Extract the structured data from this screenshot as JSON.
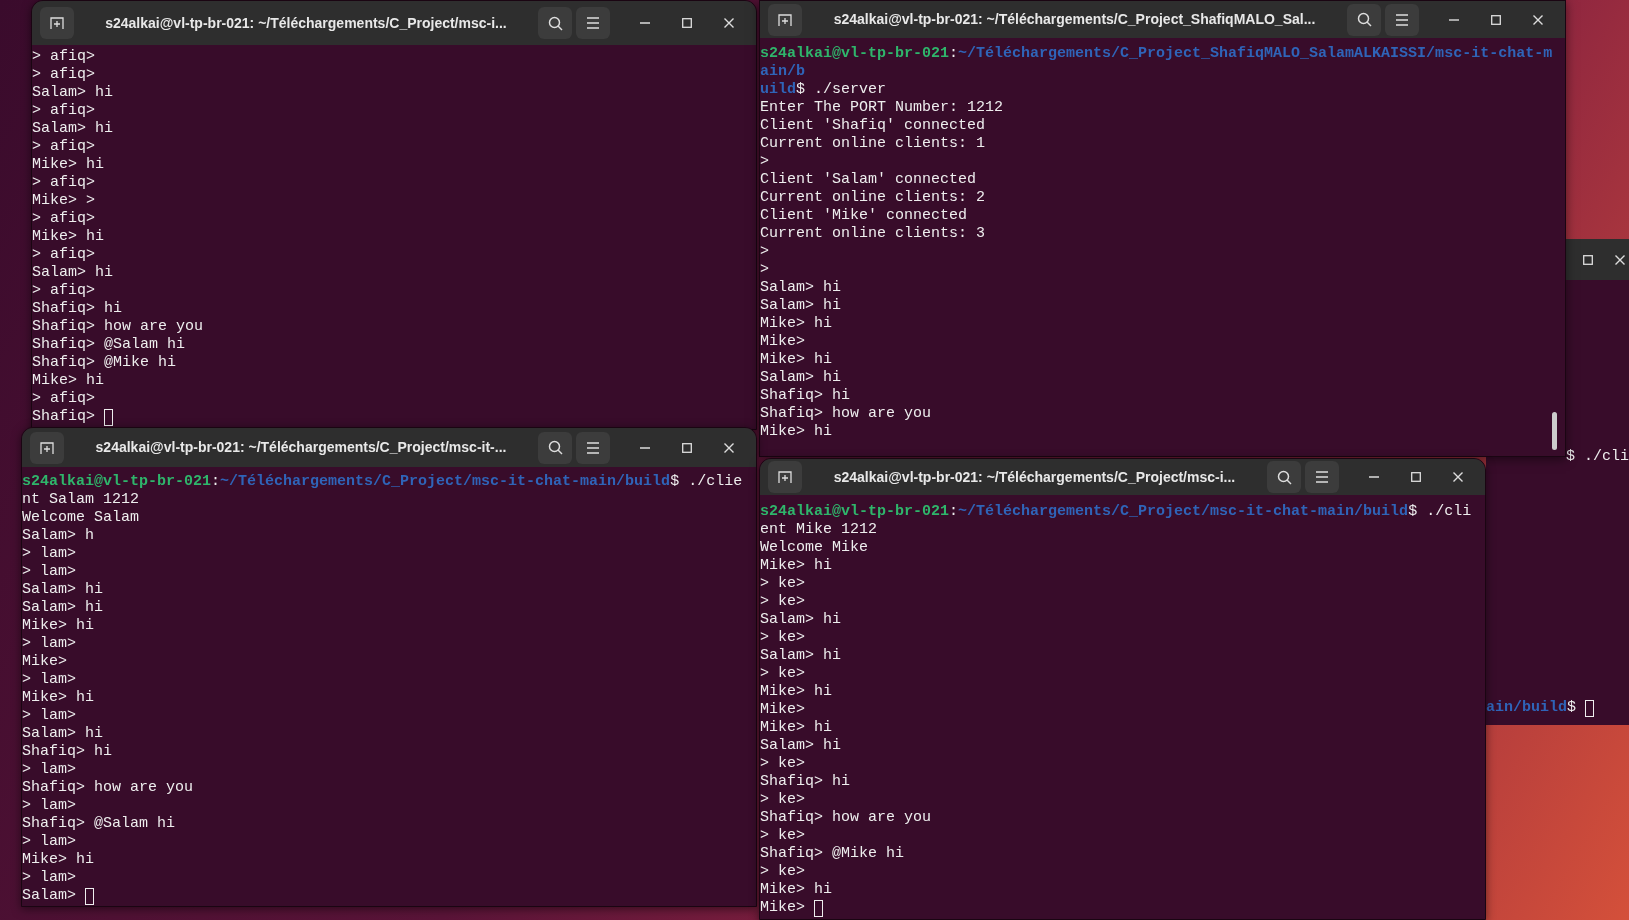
{
  "windows": [
    {
      "title": "s24alkai@vl-tp-br-021: ~/Téléchargements/C_Project/msc-i...",
      "lines": [
        "> afiq>",
        "> afiq>",
        "Salam> hi",
        "> afiq>",
        "Salam> hi",
        "> afiq>",
        "Mike> hi",
        "> afiq>",
        "Mike> >",
        "> afiq>",
        "Mike> hi",
        "> afiq>",
        "Salam> hi",
        "> afiq>",
        "Shafiq> hi",
        "Shafiq> how are you",
        "Shafiq> @Salam hi",
        "Shafiq> @Mike hi",
        "Mike> hi",
        "> afiq>",
        {
          "parts": [
            {
              "kind": "plain",
              "text": "Shafiq> "
            }
          ],
          "cursor": true
        }
      ]
    },
    {
      "title": "s24alkai@vl-tp-br-021: ~/Téléchargements/C_Project_ShafiqMALO_Sal...",
      "lines": [
        {
          "parts": [
            {
              "kind": "user",
              "text": "s24alkai@vl-tp-br-021"
            },
            {
              "kind": "plain",
              "text": ":"
            },
            {
              "kind": "path",
              "text": "~/Téléchargements/C_Project_ShafiqMALO_SalamALKAISSI/msc-it-chat-m"
            }
          ]
        },
        {
          "parts": [
            {
              "kind": "path",
              "text": "ain/b"
            }
          ]
        },
        {
          "parts": [
            {
              "kind": "path",
              "text": "uild"
            },
            {
              "kind": "plain",
              "text": "$ ./server"
            }
          ]
        },
        "Enter The PORT Number: 1212",
        "Client 'Shafiq' connected",
        "Current online clients: 1",
        ">",
        "Client 'Salam' connected",
        "Current online clients: 2",
        "Client 'Mike' connected",
        "Current online clients: 3",
        ">",
        ">",
        "Salam> hi",
        "Salam> hi",
        "Mike> hi",
        "Mike>",
        "Mike> hi",
        "Salam> hi",
        "Shafiq> hi",
        "Shafiq> how are you",
        "Mike> hi"
      ]
    },
    {
      "title": "s24alkai@vl-tp-br-021: ~/Téléchargements/C_Project/msc-it-...",
      "lines": [
        {
          "parts": [
            {
              "kind": "user",
              "text": "s24alkai@vl-tp-br-021"
            },
            {
              "kind": "plain",
              "text": ":"
            },
            {
              "kind": "path",
              "text": "~/Téléchargements/C_Project/msc-it-chat-main/build"
            },
            {
              "kind": "plain",
              "text": "$ ./clie"
            }
          ]
        },
        "nt Salam 1212",
        "Welcome Salam",
        "Salam> h",
        "> lam>",
        "> lam>",
        "Salam> hi",
        "Salam> hi",
        "Mike> hi",
        "> lam>",
        "Mike>",
        "> lam>",
        "Mike> hi",
        "> lam>",
        "Salam> hi",
        "Shafiq> hi",
        "> lam>",
        "Shafiq> how are you",
        "> lam>",
        "Shafiq> @Salam hi",
        "> lam>",
        "Mike> hi",
        "> lam>",
        {
          "parts": [
            {
              "kind": "plain",
              "text": "Salam> "
            }
          ],
          "cursor": true
        }
      ]
    },
    {
      "title": "s24alkai@vl-tp-br-021: ~/Téléchargements/C_Project/msc-i...",
      "lines": [
        {
          "parts": [
            {
              "kind": "user",
              "text": "s24alkai@vl-tp-br-021"
            },
            {
              "kind": "plain",
              "text": ":"
            },
            {
              "kind": "path",
              "text": "~/Téléchargements/C_Project/msc-it-chat-main/build"
            },
            {
              "kind": "plain",
              "text": "$ ./cli"
            }
          ]
        },
        "ent Mike 1212",
        "Welcome Mike",
        "Mike> hi",
        "> ke>",
        "> ke>",
        "Salam> hi",
        "> ke>",
        "Salam> hi",
        "> ke>",
        "Mike> hi",
        "Mike>",
        "Mike> hi",
        "Salam> hi",
        "> ke>",
        "Shafiq> hi",
        "> ke>",
        "Shafiq> how are you",
        "> ke>",
        "Shafiq> @Mike hi",
        "> ke>",
        "Mike> hi",
        {
          "parts": [
            {
              "kind": "plain",
              "text": "Mike> "
            }
          ],
          "cursor": true
        }
      ]
    }
  ],
  "background_window": {
    "lines": [
      {
        "parts": [
          {
            "kind": "plain",
            "text": "$ ./cli"
          }
        ]
      },
      {
        "parts": [
          {
            "kind": "path",
            "text": "ain/build"
          },
          {
            "kind": "plain",
            "text": "$ "
          }
        ],
        "cursor": true
      }
    ]
  }
}
